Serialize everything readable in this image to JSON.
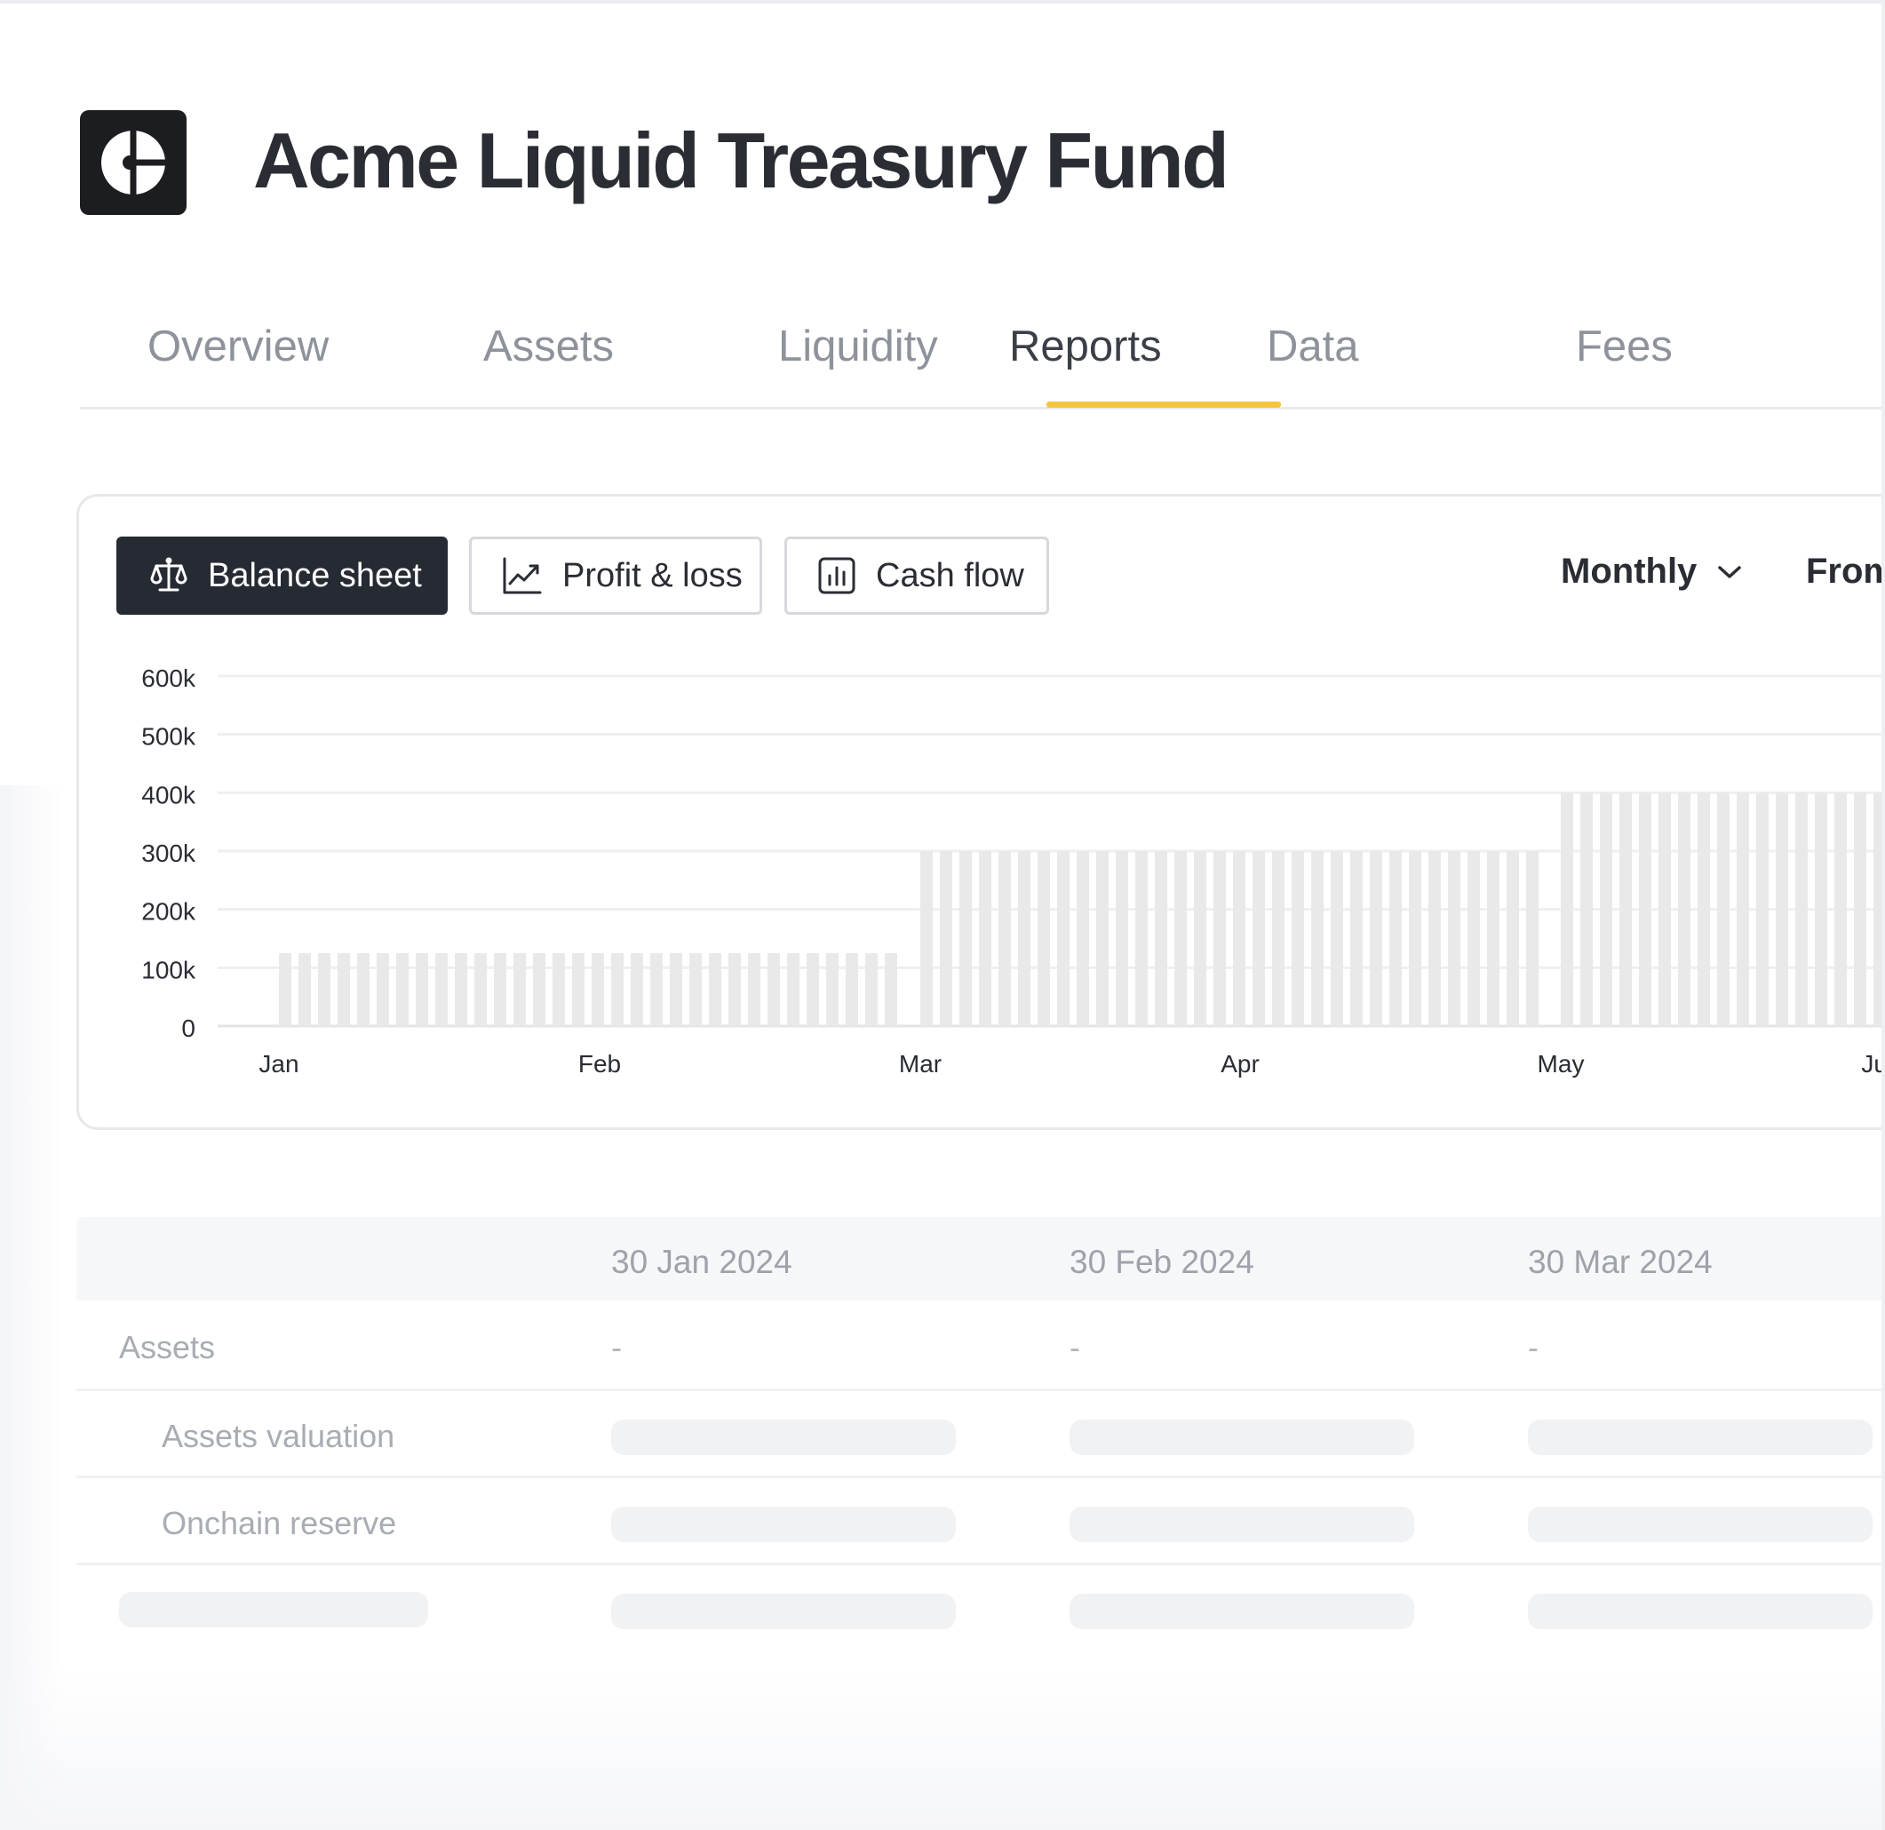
{
  "app": {
    "title": "Acme Liquid Treasury Fund"
  },
  "tabs": [
    {
      "label": "Overview"
    },
    {
      "label": "Assets"
    },
    {
      "label": "Liquidity"
    },
    {
      "label": "Reports",
      "active": true
    },
    {
      "label": "Data"
    },
    {
      "label": "Fees"
    }
  ],
  "report": {
    "types": [
      {
        "label": "Balance sheet",
        "icon": "scale-icon",
        "active": true
      },
      {
        "label": "Profit & loss",
        "icon": "trend-up-icon"
      },
      {
        "label": "Cash flow",
        "icon": "bar-chart-icon"
      }
    ],
    "period": {
      "label": "Monthly",
      "icon": "chevron-down-icon"
    },
    "from_label": "From"
  },
  "chart_data": {
    "type": "bar",
    "title": "",
    "xlabel": "",
    "ylabel": "",
    "ylim": [
      0,
      600000
    ],
    "y_ticks": [
      {
        "value": 0,
        "label": "0"
      },
      {
        "value": 100000,
        "label": "100k"
      },
      {
        "value": 200000,
        "label": "200k"
      },
      {
        "value": 300000,
        "label": "300k"
      },
      {
        "value": 400000,
        "label": "400k"
      },
      {
        "value": 500000,
        "label": "500k"
      },
      {
        "value": 600000,
        "label": "600k"
      }
    ],
    "x_ticks": [
      "Jan",
      "Feb",
      "Mar",
      "Apr",
      "May",
      "Jun"
    ],
    "grid": true,
    "bar_color": "#e9e9ea",
    "segments": [
      {
        "from": "Jan",
        "to": "Feb",
        "bars": 32,
        "value": 125000
      },
      {
        "from": "Feb",
        "to": "Mar",
        "bars": 0,
        "value": 125000
      },
      {
        "from": "Mar",
        "to": "Apr",
        "bars": 32,
        "value": 300000
      },
      {
        "from": "Apr",
        "to": "May",
        "bars": 0,
        "value": 300000
      },
      {
        "from": "May",
        "to": "Jun",
        "bars": 18,
        "value": 400000
      }
    ]
  },
  "table": {
    "columns": [
      "",
      "30 Jan 2024",
      "30 Feb 2024",
      "30 Mar 2024"
    ],
    "rows": [
      {
        "label": "Assets",
        "values": [
          "-",
          "-",
          "-"
        ]
      },
      {
        "label": "Assets valuation",
        "values": [
          null,
          null,
          null
        ]
      },
      {
        "label": "Onchain reserve",
        "values": [
          null,
          null,
          null
        ]
      },
      {
        "label": null,
        "values": [
          null,
          null,
          null
        ]
      }
    ]
  },
  "colors": {
    "accent": "#f5c53e",
    "active_button": "#262a33",
    "logo_bg": "#1c1d20"
  }
}
